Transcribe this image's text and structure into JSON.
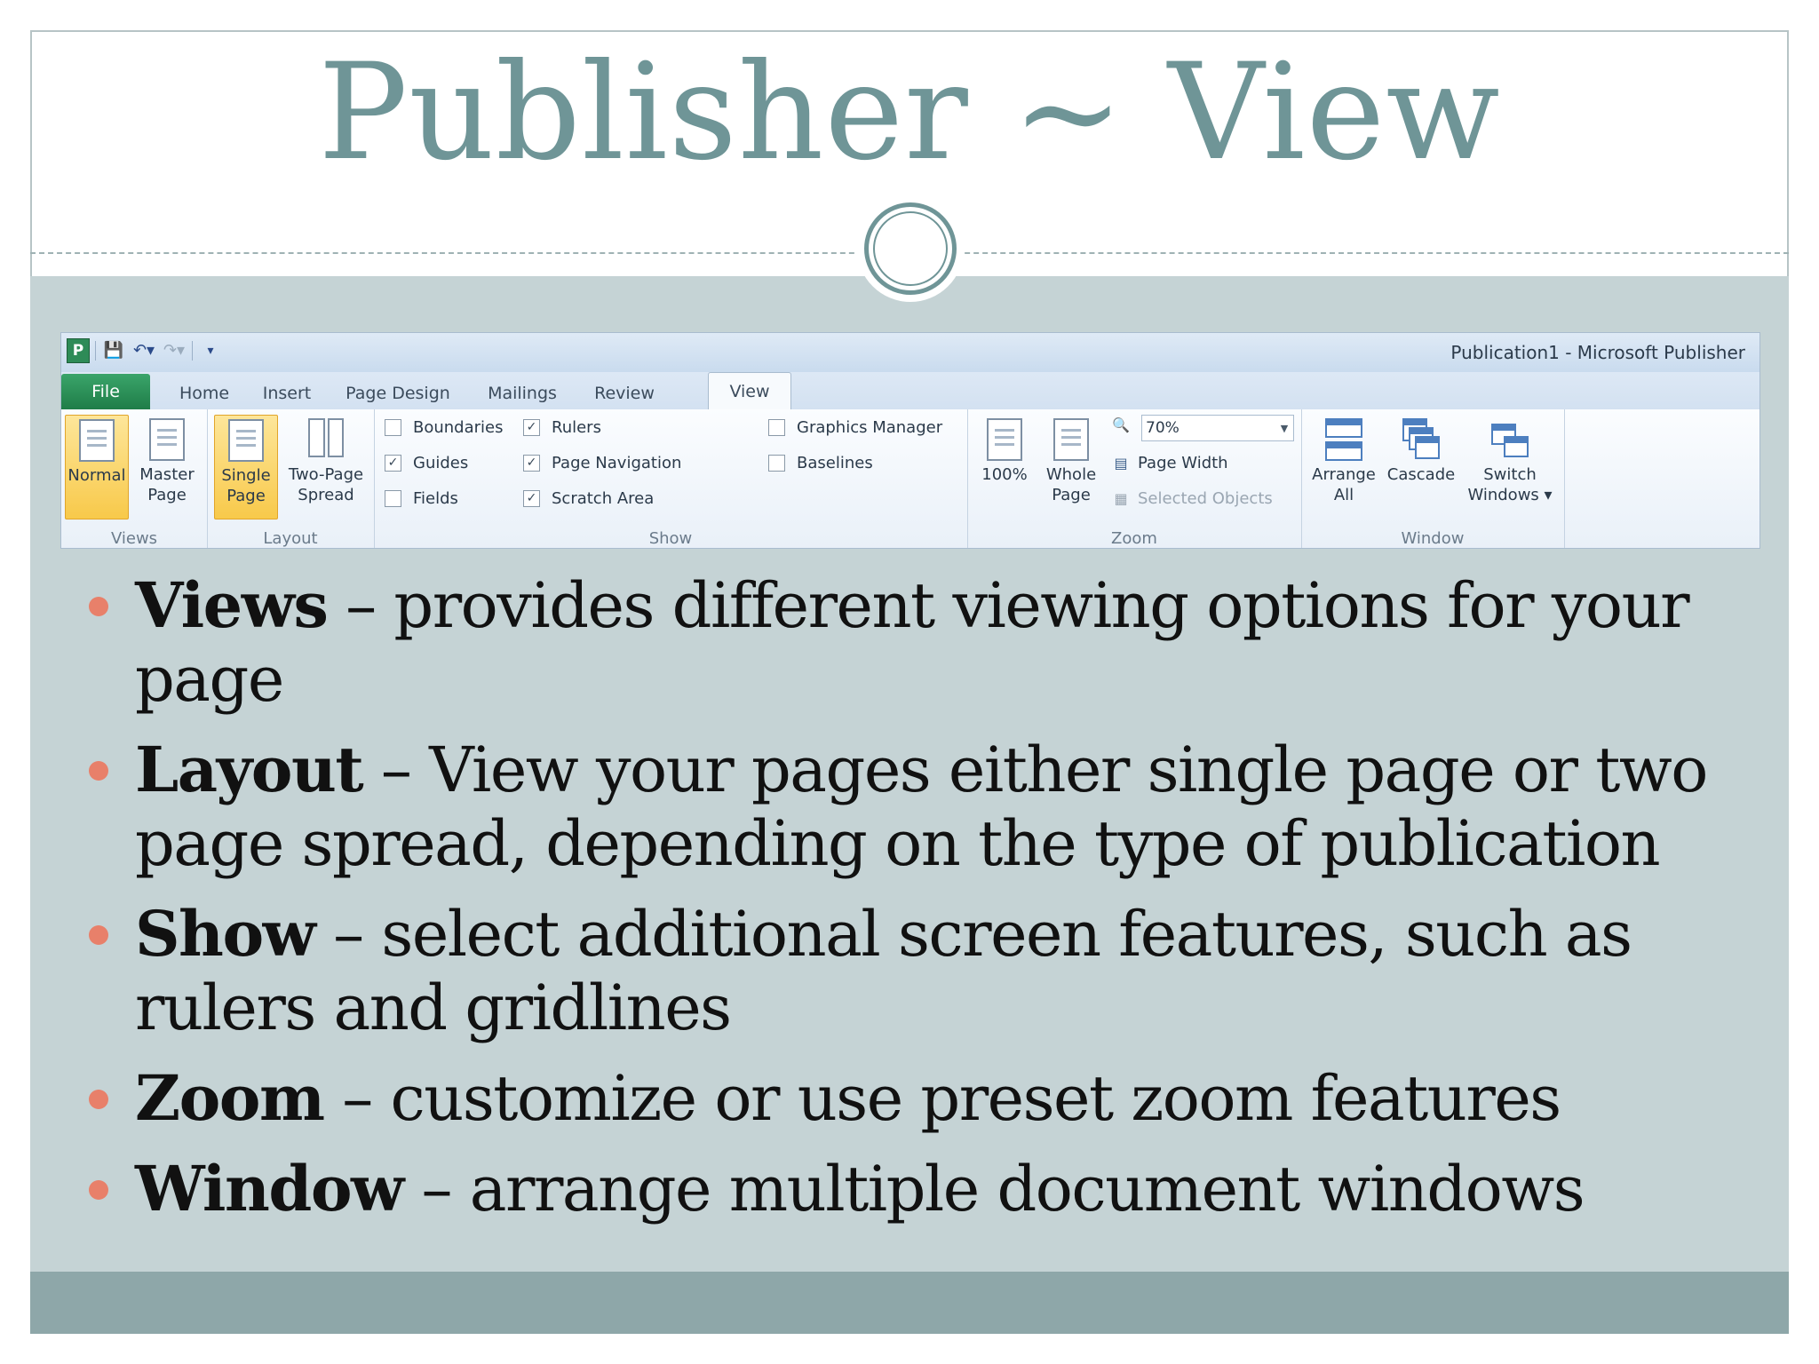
{
  "slide": {
    "title": "Publisher ~ View",
    "colors": {
      "title": "#6f9597",
      "content_bg": "#c5d3d5",
      "footer": "#8ea7a9",
      "bullet": "#e8806a"
    }
  },
  "ribbon": {
    "window_title": "Publication1  -  Microsoft Publisher",
    "app_icon": "P",
    "tabs": [
      "File",
      "Home",
      "Insert",
      "Page Design",
      "Mailings",
      "Review",
      "View"
    ],
    "active_tab": "View",
    "groups": {
      "views": {
        "label": "Views",
        "normal": [
          "Normal"
        ],
        "master": [
          "Master",
          "Page"
        ]
      },
      "layout": {
        "label": "Layout",
        "single": [
          "Single",
          "Page"
        ],
        "two_page": [
          "Two-Page",
          "Spread"
        ]
      },
      "show": {
        "label": "Show",
        "boundaries": "Boundaries",
        "guides": "Guides",
        "fields": "Fields",
        "rulers": "Rulers",
        "page_navigation": "Page Navigation",
        "scratch_area": "Scratch Area",
        "graphics_manager": "Graphics Manager",
        "baselines": "Baselines"
      },
      "zoom": {
        "label": "Zoom",
        "hundred": "100%",
        "whole": [
          "Whole",
          "Page"
        ],
        "level": "70%",
        "page_width": "Page Width",
        "selected_objects": "Selected Objects"
      },
      "window": {
        "label": "Window",
        "arrange": [
          "Arrange",
          "All"
        ],
        "cascade": "Cascade",
        "switch": [
          "Switch",
          "Windows ▾"
        ]
      }
    },
    "checkbox_states": {
      "boundaries": false,
      "guides": true,
      "fields": false,
      "rulers": true,
      "page_navigation": true,
      "scratch_area": true,
      "graphics_manager": false,
      "baselines": false
    }
  },
  "bullets": [
    {
      "term": "Views",
      "text": " – provides different viewing options for your page"
    },
    {
      "term": "Layout",
      "text": " – View your pages either single page or two page spread, depending on the type of publication"
    },
    {
      "term": "Show",
      "text": " – select additional screen features, such as rulers and gridlines"
    },
    {
      "term": "Zoom",
      "text": " – customize or use preset zoom features"
    },
    {
      "term": "Window",
      "text": " – arrange multiple document windows"
    }
  ]
}
